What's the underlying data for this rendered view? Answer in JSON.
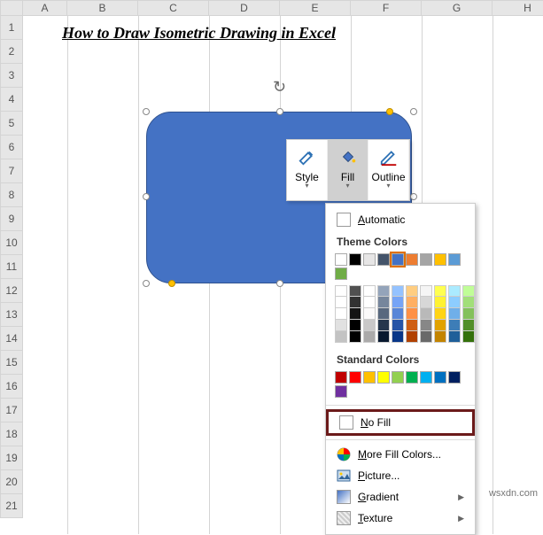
{
  "cols": [
    "A",
    "B",
    "C",
    "D",
    "E",
    "F",
    "G",
    "H"
  ],
  "rows": [
    "1",
    "2",
    "3",
    "4",
    "5",
    "6",
    "7",
    "8",
    "9",
    "10",
    "11",
    "12",
    "13",
    "14",
    "15",
    "16",
    "17",
    "18",
    "19",
    "20",
    "21"
  ],
  "title": "How to Draw Isometric Drawing in Excel",
  "toolbar": {
    "style": "Style",
    "fill": "Fill",
    "outline": "Outline"
  },
  "popup": {
    "automatic": "Automatic",
    "theme_hdr": "Theme Colors",
    "std_hdr": "Standard Colors",
    "no_fill": "No Fill",
    "more": "More Fill Colors...",
    "picture": "Picture...",
    "gradient": "Gradient",
    "texture": "Texture"
  },
  "theme_main": [
    "#ffffff",
    "#000000",
    "#e7e6e6",
    "#44546a",
    "#4472c4",
    "#ed7d31",
    "#a5a5a5",
    "#ffc000",
    "#5b9bd5",
    "#70ad47"
  ],
  "std": [
    "#c00000",
    "#ff0000",
    "#ffc000",
    "#ffff00",
    "#92d050",
    "#00b050",
    "#00b0f0",
    "#0070c0",
    "#002060",
    "#7030a0"
  ],
  "watermark": "wsxdn.com"
}
